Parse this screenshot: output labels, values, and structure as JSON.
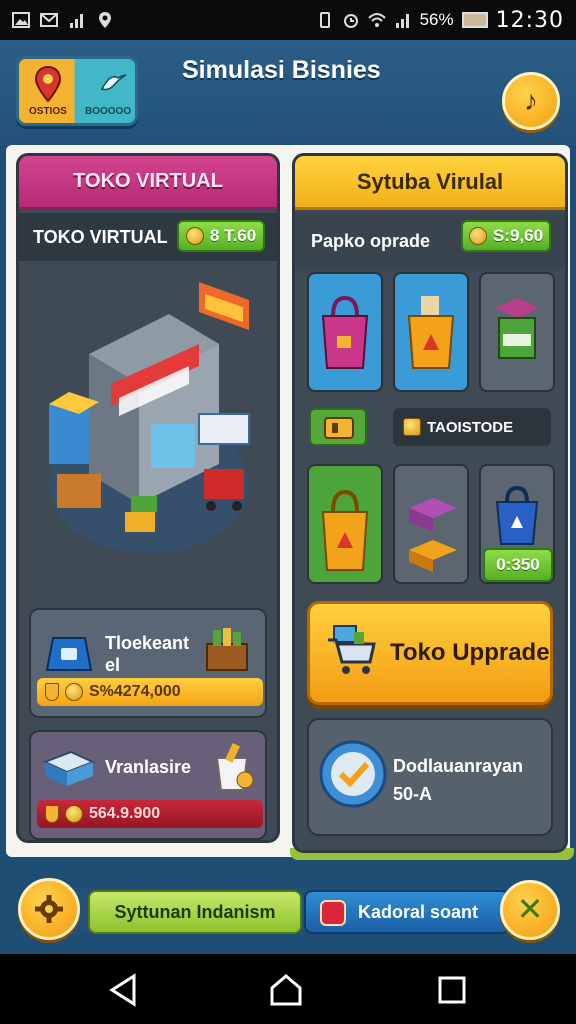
{
  "status_bar": {
    "battery_percent": "56%",
    "time": "12:30"
  },
  "header": {
    "logo_left_text": "OSTIOS",
    "logo_right_text": "BOOOOO",
    "title": "Simulasi Bisnies",
    "music_icon_glyph": "♪"
  },
  "left_panel": {
    "header": "TOKO VIRTUAL",
    "sub_label": "TOKO VIRTUAL",
    "sub_price": "8 T.60",
    "card1": {
      "title_line1": "Tloekeant",
      "title_line2": "el",
      "value": "S%4274,000"
    },
    "card2": {
      "title": "Vranlasire",
      "value": "564.9.900"
    }
  },
  "right_panel": {
    "header": "Sytuba Virulal",
    "sub_label": "Papko oprade",
    "sub_price": "S:9,60",
    "mid_label": "TAOISTODE",
    "small_price": "0:350",
    "upgrade_button": "Toko Upprade",
    "verify_line1": "Dodlauanrayan",
    "verify_line2": "50-A"
  },
  "footer": {
    "green_label": "Syttunan Indanism",
    "blue_label": "Kadoral soant",
    "close_glyph": "✕"
  },
  "colors": {
    "left_header": "#c8367f",
    "right_header": "#f7c12b",
    "coin_green": "#6cc335",
    "upgrade_orange": "#f6a51c"
  }
}
